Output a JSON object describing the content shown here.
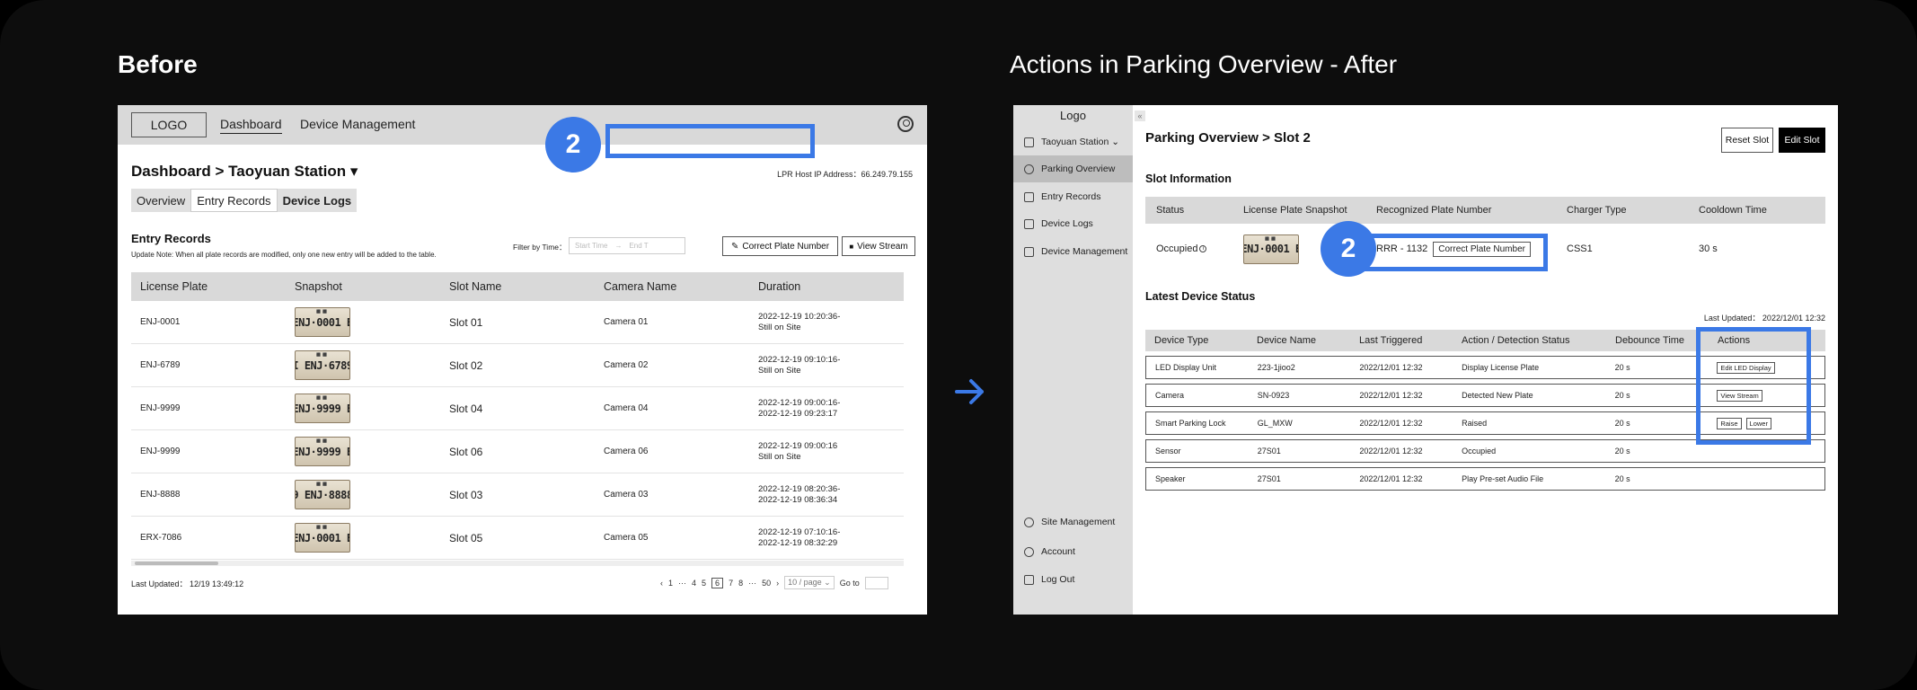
{
  "colors": {
    "highlight": "#3b79e6",
    "background": "#0d0d0d"
  },
  "before": {
    "section_title": "Before",
    "topbar": {
      "logo": "LOGO",
      "nav": [
        "Dashboard",
        "Device Management"
      ],
      "user_icon": "user-icon"
    },
    "page_title": "Dashboard > Taoyuan Station ▾",
    "lpr_host": "LPR Host IP Address：66.249.79.155",
    "tabs": [
      "Overview",
      "Entry Records",
      "Device Logs"
    ],
    "entry_heading": "Entry Records",
    "update_note": "Update Note: When all plate records are modified, only one new entry will be added to the table.",
    "filter_label": "Filter by Time：",
    "range_start_placeholder": "Start Time",
    "range_end_placeholder": "End T",
    "buttons": {
      "correct_plate": "Correct Plate Number",
      "view_stream": "View Stream"
    },
    "step_badge": "2",
    "table": {
      "headers": [
        "License Plate",
        "Snapshot",
        "Slot Name",
        "Camera Name",
        "Duration"
      ],
      "rows": [
        {
          "plate": "ENJ-0001",
          "snapshot": "ENJ·0001 E",
          "slot": "Slot 01",
          "camera": "Camera 01",
          "dur1": "2022-12-19 10:20:36-",
          "dur2": "Still on Site"
        },
        {
          "plate": "ENJ-6789",
          "snapshot": "I ENJ·6789",
          "slot": "Slot 02",
          "camera": "Camera 02",
          "dur1": "2022-12-19 09:10:16-",
          "dur2": "Still on Site"
        },
        {
          "plate": "ENJ-9999",
          "snapshot": "ENJ·9999 E",
          "slot": "Slot 04",
          "camera": "Camera 04",
          "dur1": "2022-12-19 09:00:16-",
          "dur2": "2022-12-19 09:23:17"
        },
        {
          "plate": "ENJ-9999",
          "snapshot": "ENJ·9999 E",
          "slot": "Slot 06",
          "camera": "Camera 06",
          "dur1": "2022-12-19 09:00:16",
          "dur2": "Still on Site"
        },
        {
          "plate": "ENJ-8888",
          "snapshot": "9 ENJ·8888",
          "slot": "Slot 03",
          "camera": "Camera 03",
          "dur1": "2022-12-19 08:20:36-",
          "dur2": "2022-12-19 08:36:34"
        },
        {
          "plate": "ERX-7086",
          "snapshot": "ENJ·0001 E",
          "slot": "Slot 05",
          "camera": "Camera 05",
          "dur1": "2022-12-19 07:10:16-",
          "dur2": "2022-12-19 08:32:29"
        }
      ]
    },
    "last_updated": "Last Updated： 12/19 13:49:12",
    "pager": {
      "prev": "‹",
      "pages": [
        "1",
        "···",
        "4",
        "5",
        "6",
        "7",
        "8",
        "···",
        "50"
      ],
      "current": "6",
      "next": "›",
      "page_size": "10 / page ⌄",
      "goto": "Go to"
    }
  },
  "after": {
    "section_title": "Actions in Parking Overview - After",
    "sidebar": {
      "logo": "Logo",
      "collapse": "«",
      "station": "Taoyuan Station ⌄",
      "items": [
        "Parking Overview",
        "Entry Records",
        "Device Logs",
        "Device Management"
      ],
      "bottom_items": [
        "Site Management",
        "Account",
        "Log Out"
      ]
    },
    "page_title": "Parking Overview  >  Slot 2",
    "buttons": {
      "reset_slot": "Reset Slot",
      "edit_slot": "Edit Slot"
    },
    "slot_info": {
      "heading": "Slot Information",
      "headers": [
        "Status",
        "License Plate Snapshot",
        "Recognized Plate Number",
        "Charger Type",
        "Cooldown Time"
      ],
      "status": "Occupied",
      "info_icon": "i",
      "snapshot": "ENJ·0001 E",
      "plate_number": "RRR - 1132",
      "correct_button": "Correct Plate Number",
      "charger": "CSS1",
      "cooldown": "30 s"
    },
    "step_badge": "2",
    "device_status": {
      "heading": "Latest Device Status",
      "last_updated": "Last Updated： 2022/12/01 12:32",
      "headers": [
        "Device Type",
        "Device Name",
        "Last Triggered",
        "Action / Detection Status",
        "Debounce Time",
        "Actions"
      ],
      "rows": [
        {
          "type": "LED Display Unit",
          "name": "223-1jioo2",
          "triggered": "2022/12/01 12:32",
          "status": "Display License Plate",
          "debounce": "20 s",
          "actions": [
            "Edit LED Display"
          ]
        },
        {
          "type": "Camera",
          "name": "SN-0923",
          "triggered": "2022/12/01 12:32",
          "status": "Detected New Plate",
          "debounce": "20 s",
          "actions": [
            "View Stream"
          ]
        },
        {
          "type": "Smart Parking Lock",
          "name": "GL_MXW",
          "triggered": "2022/12/01 12:32",
          "status": "Raised",
          "debounce": "20 s",
          "actions": [
            "Raise",
            "Lower"
          ]
        },
        {
          "type": "Sensor",
          "name": "27S01",
          "triggered": "2022/12/01 12:32",
          "status": "Occupied",
          "debounce": "20 s",
          "actions": []
        },
        {
          "type": "Speaker",
          "name": "27S01",
          "triggered": "2022/12/01 12:32",
          "status": "Play Pre-set Audio File",
          "debounce": "20 s",
          "actions": []
        }
      ]
    }
  }
}
